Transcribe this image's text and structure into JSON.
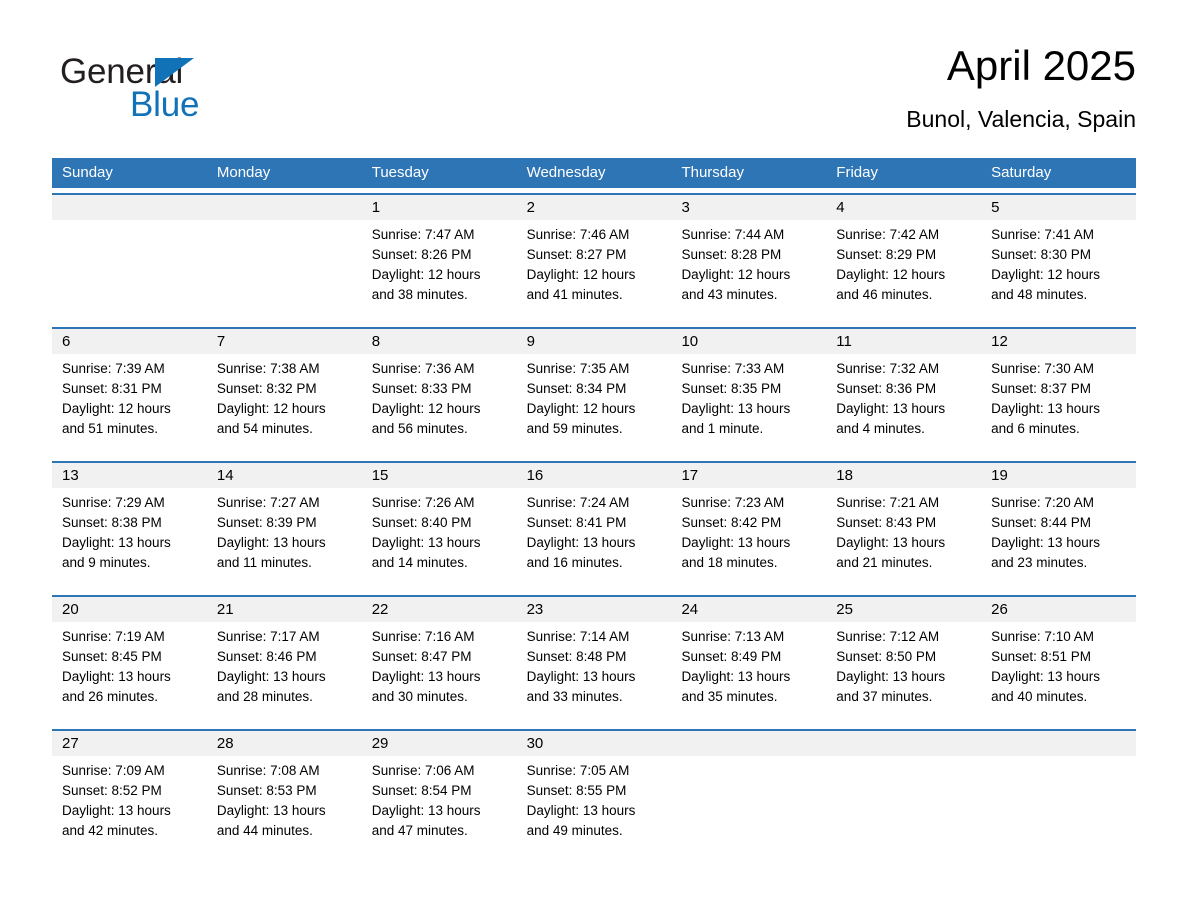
{
  "brand": {
    "name_part1": "General",
    "name_part2": "Blue",
    "triangle_icon": "triangle-icon",
    "color_dark": "#231f20",
    "color_blue": "#1272b8"
  },
  "header": {
    "title": "April 2025",
    "subtitle": "Bunol, Valencia, Spain"
  },
  "theme": {
    "header_blue": "#2e75b6",
    "daynum_band": "#f1f1f1",
    "rule_blue": "#2e75b6",
    "text": "#000000"
  },
  "weekdays": [
    {
      "label": "Sunday"
    },
    {
      "label": "Monday"
    },
    {
      "label": "Tuesday"
    },
    {
      "label": "Wednesday"
    },
    {
      "label": "Thursday"
    },
    {
      "label": "Friday"
    },
    {
      "label": "Saturday"
    }
  ],
  "weeks": [
    {
      "days": [
        {
          "num": "",
          "sunrise": "",
          "sunset": "",
          "daylight1": "",
          "daylight2": ""
        },
        {
          "num": "",
          "sunrise": "",
          "sunset": "",
          "daylight1": "",
          "daylight2": ""
        },
        {
          "num": "1",
          "sunrise": "Sunrise: 7:47 AM",
          "sunset": "Sunset: 8:26 PM",
          "daylight1": "Daylight: 12 hours",
          "daylight2": "and 38 minutes."
        },
        {
          "num": "2",
          "sunrise": "Sunrise: 7:46 AM",
          "sunset": "Sunset: 8:27 PM",
          "daylight1": "Daylight: 12 hours",
          "daylight2": "and 41 minutes."
        },
        {
          "num": "3",
          "sunrise": "Sunrise: 7:44 AM",
          "sunset": "Sunset: 8:28 PM",
          "daylight1": "Daylight: 12 hours",
          "daylight2": "and 43 minutes."
        },
        {
          "num": "4",
          "sunrise": "Sunrise: 7:42 AM",
          "sunset": "Sunset: 8:29 PM",
          "daylight1": "Daylight: 12 hours",
          "daylight2": "and 46 minutes."
        },
        {
          "num": "5",
          "sunrise": "Sunrise: 7:41 AM",
          "sunset": "Sunset: 8:30 PM",
          "daylight1": "Daylight: 12 hours",
          "daylight2": "and 48 minutes."
        }
      ]
    },
    {
      "days": [
        {
          "num": "6",
          "sunrise": "Sunrise: 7:39 AM",
          "sunset": "Sunset: 8:31 PM",
          "daylight1": "Daylight: 12 hours",
          "daylight2": "and 51 minutes."
        },
        {
          "num": "7",
          "sunrise": "Sunrise: 7:38 AM",
          "sunset": "Sunset: 8:32 PM",
          "daylight1": "Daylight: 12 hours",
          "daylight2": "and 54 minutes."
        },
        {
          "num": "8",
          "sunrise": "Sunrise: 7:36 AM",
          "sunset": "Sunset: 8:33 PM",
          "daylight1": "Daylight: 12 hours",
          "daylight2": "and 56 minutes."
        },
        {
          "num": "9",
          "sunrise": "Sunrise: 7:35 AM",
          "sunset": "Sunset: 8:34 PM",
          "daylight1": "Daylight: 12 hours",
          "daylight2": "and 59 minutes."
        },
        {
          "num": "10",
          "sunrise": "Sunrise: 7:33 AM",
          "sunset": "Sunset: 8:35 PM",
          "daylight1": "Daylight: 13 hours",
          "daylight2": "and 1 minute."
        },
        {
          "num": "11",
          "sunrise": "Sunrise: 7:32 AM",
          "sunset": "Sunset: 8:36 PM",
          "daylight1": "Daylight: 13 hours",
          "daylight2": "and 4 minutes."
        },
        {
          "num": "12",
          "sunrise": "Sunrise: 7:30 AM",
          "sunset": "Sunset: 8:37 PM",
          "daylight1": "Daylight: 13 hours",
          "daylight2": "and 6 minutes."
        }
      ]
    },
    {
      "days": [
        {
          "num": "13",
          "sunrise": "Sunrise: 7:29 AM",
          "sunset": "Sunset: 8:38 PM",
          "daylight1": "Daylight: 13 hours",
          "daylight2": "and 9 minutes."
        },
        {
          "num": "14",
          "sunrise": "Sunrise: 7:27 AM",
          "sunset": "Sunset: 8:39 PM",
          "daylight1": "Daylight: 13 hours",
          "daylight2": "and 11 minutes."
        },
        {
          "num": "15",
          "sunrise": "Sunrise: 7:26 AM",
          "sunset": "Sunset: 8:40 PM",
          "daylight1": "Daylight: 13 hours",
          "daylight2": "and 14 minutes."
        },
        {
          "num": "16",
          "sunrise": "Sunrise: 7:24 AM",
          "sunset": "Sunset: 8:41 PM",
          "daylight1": "Daylight: 13 hours",
          "daylight2": "and 16 minutes."
        },
        {
          "num": "17",
          "sunrise": "Sunrise: 7:23 AM",
          "sunset": "Sunset: 8:42 PM",
          "daylight1": "Daylight: 13 hours",
          "daylight2": "and 18 minutes."
        },
        {
          "num": "18",
          "sunrise": "Sunrise: 7:21 AM",
          "sunset": "Sunset: 8:43 PM",
          "daylight1": "Daylight: 13 hours",
          "daylight2": "and 21 minutes."
        },
        {
          "num": "19",
          "sunrise": "Sunrise: 7:20 AM",
          "sunset": "Sunset: 8:44 PM",
          "daylight1": "Daylight: 13 hours",
          "daylight2": "and 23 minutes."
        }
      ]
    },
    {
      "days": [
        {
          "num": "20",
          "sunrise": "Sunrise: 7:19 AM",
          "sunset": "Sunset: 8:45 PM",
          "daylight1": "Daylight: 13 hours",
          "daylight2": "and 26 minutes."
        },
        {
          "num": "21",
          "sunrise": "Sunrise: 7:17 AM",
          "sunset": "Sunset: 8:46 PM",
          "daylight1": "Daylight: 13 hours",
          "daylight2": "and 28 minutes."
        },
        {
          "num": "22",
          "sunrise": "Sunrise: 7:16 AM",
          "sunset": "Sunset: 8:47 PM",
          "daylight1": "Daylight: 13 hours",
          "daylight2": "and 30 minutes."
        },
        {
          "num": "23",
          "sunrise": "Sunrise: 7:14 AM",
          "sunset": "Sunset: 8:48 PM",
          "daylight1": "Daylight: 13 hours",
          "daylight2": "and 33 minutes."
        },
        {
          "num": "24",
          "sunrise": "Sunrise: 7:13 AM",
          "sunset": "Sunset: 8:49 PM",
          "daylight1": "Daylight: 13 hours",
          "daylight2": "and 35 minutes."
        },
        {
          "num": "25",
          "sunrise": "Sunrise: 7:12 AM",
          "sunset": "Sunset: 8:50 PM",
          "daylight1": "Daylight: 13 hours",
          "daylight2": "and 37 minutes."
        },
        {
          "num": "26",
          "sunrise": "Sunrise: 7:10 AM",
          "sunset": "Sunset: 8:51 PM",
          "daylight1": "Daylight: 13 hours",
          "daylight2": "and 40 minutes."
        }
      ]
    },
    {
      "days": [
        {
          "num": "27",
          "sunrise": "Sunrise: 7:09 AM",
          "sunset": "Sunset: 8:52 PM",
          "daylight1": "Daylight: 13 hours",
          "daylight2": "and 42 minutes."
        },
        {
          "num": "28",
          "sunrise": "Sunrise: 7:08 AM",
          "sunset": "Sunset: 8:53 PM",
          "daylight1": "Daylight: 13 hours",
          "daylight2": "and 44 minutes."
        },
        {
          "num": "29",
          "sunrise": "Sunrise: 7:06 AM",
          "sunset": "Sunset: 8:54 PM",
          "daylight1": "Daylight: 13 hours",
          "daylight2": "and 47 minutes."
        },
        {
          "num": "30",
          "sunrise": "Sunrise: 7:05 AM",
          "sunset": "Sunset: 8:55 PM",
          "daylight1": "Daylight: 13 hours",
          "daylight2": "and 49 minutes."
        },
        {
          "num": "",
          "sunrise": "",
          "sunset": "",
          "daylight1": "",
          "daylight2": ""
        },
        {
          "num": "",
          "sunrise": "",
          "sunset": "",
          "daylight1": "",
          "daylight2": ""
        },
        {
          "num": "",
          "sunrise": "",
          "sunset": "",
          "daylight1": "",
          "daylight2": ""
        }
      ]
    }
  ]
}
